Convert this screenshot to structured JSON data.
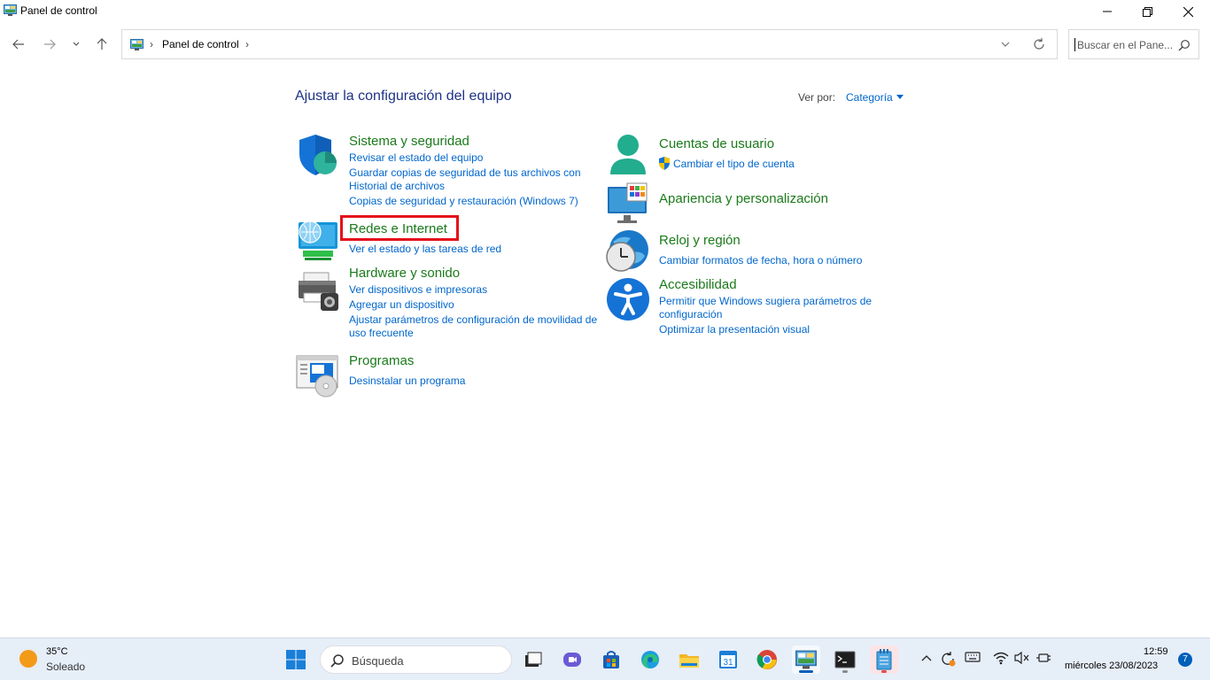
{
  "window": {
    "title": "Panel de control"
  },
  "address": {
    "crumb": "Panel de control",
    "sep": "›"
  },
  "search": {
    "placeholder": "Buscar en el Pane..."
  },
  "content": {
    "heading": "Ajustar la configuración del equipo",
    "view_by_label": "Ver por:",
    "view_by_value": "Categoría"
  },
  "categories": {
    "system": {
      "title": "Sistema y seguridad",
      "links": [
        "Revisar el estado del equipo",
        "Guardar copias de seguridad de tus archivos con",
        "Historial de archivos",
        "Copias de seguridad y restauración (Windows 7)"
      ]
    },
    "network": {
      "title": "Redes e Internet",
      "links": [
        "Ver el estado y las tareas de red"
      ]
    },
    "hardware": {
      "title": "Hardware y sonido",
      "links": [
        "Ver dispositivos e impresoras",
        "Agregar un dispositivo",
        "Ajustar parámetros de configuración de movilidad de",
        "uso frecuente"
      ]
    },
    "programs": {
      "title": "Programas",
      "links": [
        "Desinstalar un programa"
      ]
    },
    "accounts": {
      "title": "Cuentas de usuario",
      "links": [
        "Cambiar el tipo de cuenta"
      ]
    },
    "appearance": {
      "title": "Apariencia y personalización",
      "links": []
    },
    "clock": {
      "title": "Reloj y región",
      "links": [
        "Cambiar formatos de fecha, hora o número"
      ]
    },
    "accessibility": {
      "title": "Accesibilidad",
      "links": [
        "Permitir que Windows sugiera parámetros de",
        "configuración",
        "Optimizar la presentación visual"
      ]
    }
  },
  "taskbar": {
    "weather_temp": "35°C",
    "weather_condition": "Soleado",
    "search_placeholder": "Búsqueda",
    "time": "12:59",
    "date": "miércoles 23/08/2023",
    "notification_count": "7"
  },
  "colors": {
    "heading": "#1e3287",
    "category_title": "#1a7a1a",
    "link": "#0066cc",
    "highlight": "#e4101a",
    "taskbar": "#e6eef8"
  }
}
